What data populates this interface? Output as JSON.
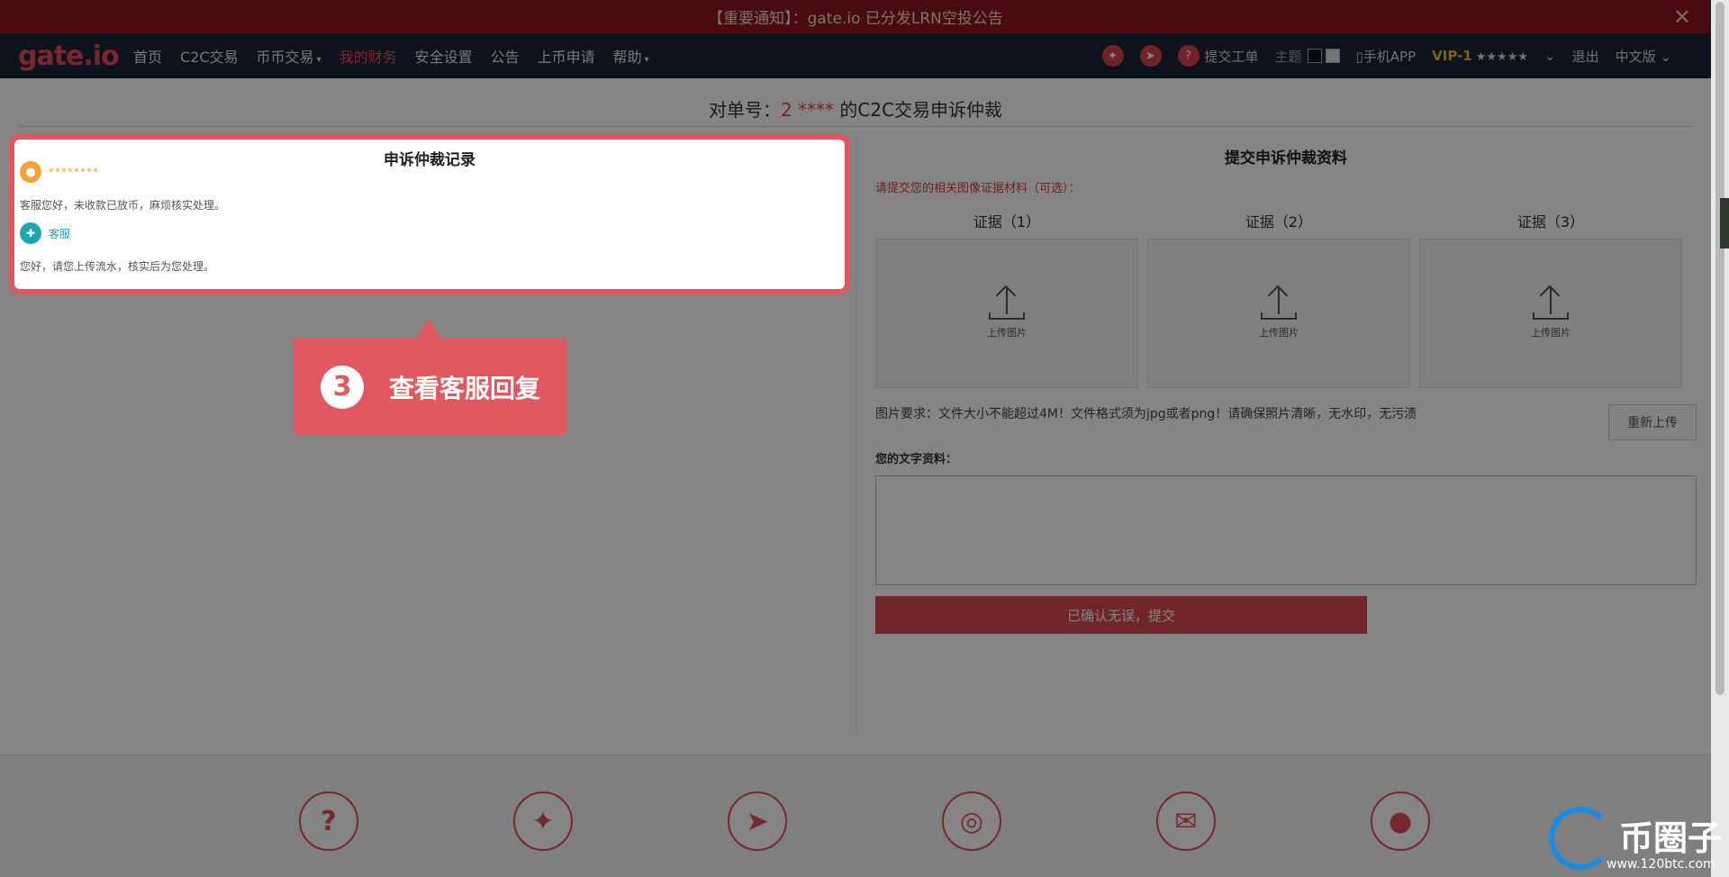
{
  "notice": {
    "text": "【重要通知】：gate.io 已分发LRN空投公告",
    "close": "✕"
  },
  "nav": {
    "logo": "gate.io",
    "links": [
      "首页",
      "C2C交易",
      "币币交易",
      "我的财务",
      "安全设置",
      "公告",
      "上币申请",
      "帮助"
    ],
    "right": {
      "ticket": "提交工单",
      "theme": "主题",
      "app": "手机APP",
      "vip": "VIP-1",
      "vip_stars": "★★★★★",
      "logout": "退出",
      "lang": "中文版"
    }
  },
  "page": {
    "title_prefix": "对单号：",
    "order_no": "2 ****",
    "title_suffix": "的C2C交易申诉仲裁"
  },
  "record": {
    "title": "申诉仲裁记录",
    "user_name": "********",
    "user_msg": "客服您好，未收款已放币，麻烦核实处理。",
    "cs_name": "客服",
    "cs_msg": "您好，请您上传流水，核实后为您处理。"
  },
  "submit_panel": {
    "title": "提交申诉仲裁资料",
    "hint": "请提交您的相关图像证据材料（可选）：",
    "evidence": [
      {
        "label": "证据（1）",
        "upload": "上传图片"
      },
      {
        "label": "证据（2）",
        "upload": "上传图片"
      },
      {
        "label": "证据（3）",
        "upload": "上传图片"
      }
    ],
    "requirement": "图片要求：文件大小不能超过4M！文件格式须为jpg或者png！请确保照片清晰，无水印，无污渍",
    "reupload": "重新上传",
    "text_label": "您的文字资料：",
    "text_value": "",
    "submit": "已确认无误，提交"
  },
  "callout": {
    "step": "3",
    "text": "查看客服回复"
  },
  "watermark": {
    "name": "币圈子",
    "url": "www.120btc.com"
  },
  "colors": {
    "accent": "#e2565e",
    "nav_bg": "#1c2336",
    "notice_bg": "#8a1820"
  }
}
